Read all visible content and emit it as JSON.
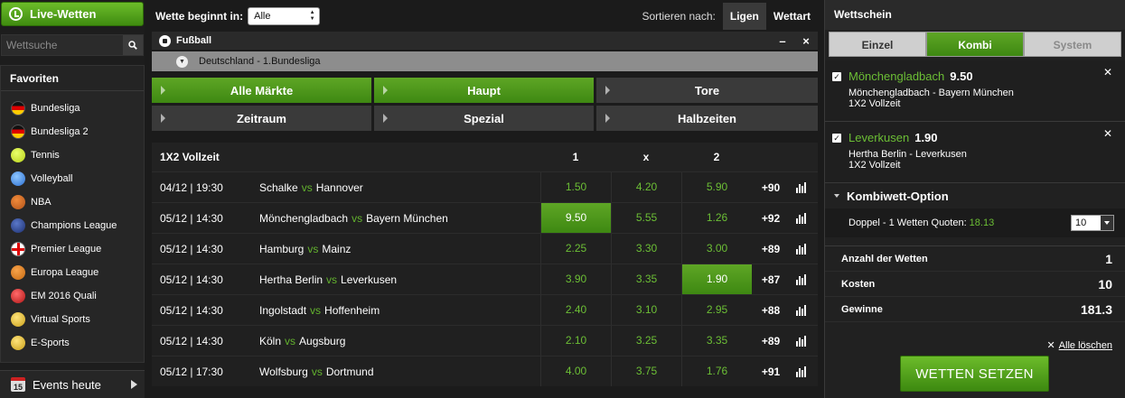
{
  "sidebar": {
    "live_label": "Live-Wetten",
    "search_placeholder": "Wettsuche",
    "favorites_title": "Favoriten",
    "items": [
      {
        "label": "Bundesliga",
        "icon": "germany-flag-icon"
      },
      {
        "label": "Bundesliga 2",
        "icon": "germany-flag-icon"
      },
      {
        "label": "Tennis",
        "icon": "tennis-ball-icon"
      },
      {
        "label": "Volleyball",
        "icon": "volleyball-icon"
      },
      {
        "label": "NBA",
        "icon": "basketball-icon"
      },
      {
        "label": "Champions League",
        "icon": "champions-league-icon"
      },
      {
        "label": "Premier League",
        "icon": "england-flag-icon"
      },
      {
        "label": "Europa League",
        "icon": "europa-league-icon"
      },
      {
        "label": "EM 2016 Quali",
        "icon": "euro-2016-icon"
      },
      {
        "label": "Virtual Sports",
        "icon": "trophy-icon"
      },
      {
        "label": "E-Sports",
        "icon": "trophy-icon"
      }
    ],
    "events_label": "Events heute",
    "events_day": "15"
  },
  "header": {
    "starts_label": "Wette beginnt in:",
    "starts_value": "Alle",
    "sort_label": "Sortieren nach:",
    "sort_leagues": "Ligen",
    "sort_bettype": "Wettart"
  },
  "sport": {
    "title": "Fußball",
    "minimize": "–",
    "close": "×"
  },
  "league": {
    "title": "Deutschland - 1.Bundesliga"
  },
  "markets": [
    {
      "label": "Alle Märkte",
      "active": true
    },
    {
      "label": "Haupt",
      "active": true
    },
    {
      "label": "Tore",
      "active": false
    },
    {
      "label": "Zeitraum",
      "active": false
    },
    {
      "label": "Spezial",
      "active": false
    },
    {
      "label": "Halbzeiten",
      "active": false
    }
  ],
  "table": {
    "title": "1X2 Vollzeit",
    "col1": "1",
    "colx": "x",
    "col2": "2",
    "vs": "vs",
    "rows": [
      {
        "time": "04/12 | 19:30",
        "home": "Schalke",
        "away": "Hannover",
        "o1": "1.50",
        "ox": "4.20",
        "o2": "5.90",
        "more": "+90"
      },
      {
        "time": "05/12 | 14:30",
        "home": "Mönchengladbach",
        "away": "Bayern München",
        "o1": "9.50",
        "ox": "5.55",
        "o2": "1.26",
        "more": "+92"
      },
      {
        "time": "05/12 | 14:30",
        "home": "Hamburg",
        "away": "Mainz",
        "o1": "2.25",
        "ox": "3.30",
        "o2": "3.00",
        "more": "+89"
      },
      {
        "time": "05/12 | 14:30",
        "home": "Hertha Berlin",
        "away": "Leverkusen",
        "o1": "3.90",
        "ox": "3.35",
        "o2": "1.90",
        "more": "+87"
      },
      {
        "time": "05/12 | 14:30",
        "home": "Ingolstadt",
        "away": "Hoffenheim",
        "o1": "2.40",
        "ox": "3.10",
        "o2": "2.95",
        "more": "+88"
      },
      {
        "time": "05/12 | 14:30",
        "home": "Köln",
        "away": "Augsburg",
        "o1": "2.10",
        "ox": "3.25",
        "o2": "3.35",
        "more": "+89"
      },
      {
        "time": "05/12 | 17:30",
        "home": "Wolfsburg",
        "away": "Dortmund",
        "o1": "4.00",
        "ox": "3.75",
        "o2": "1.76",
        "more": "+91"
      }
    ]
  },
  "betslip": {
    "title": "Wettschein",
    "tabs": [
      "Einzel",
      "Kombi",
      "System"
    ],
    "bets": [
      {
        "team": "Mönchengladbach",
        "odd": "9.50",
        "match": "Mönchengladbach - Bayern München",
        "market": "1X2 Vollzeit"
      },
      {
        "team": "Leverkusen",
        "odd": "1.90",
        "match": "Hertha Berlin - Leverkusen",
        "market": "1X2 Vollzeit"
      }
    ],
    "kombi_title": "Kombiwett-Option",
    "doppel_label": "Doppel - 1 Wetten Quoten:",
    "doppel_quote": "18.13",
    "stake_value": "10",
    "summary": {
      "count_label": "Anzahl der Wetten",
      "count_value": "1",
      "cost_label": "Kosten",
      "cost_value": "10",
      "win_label": "Gewinne",
      "win_value": "181.3"
    },
    "clear_label": "Alle löschen",
    "submit_label": "WETTEN SETZEN"
  },
  "colors": {
    "accent_green": "#4f9a1c",
    "odds_green": "#6cbf35"
  }
}
